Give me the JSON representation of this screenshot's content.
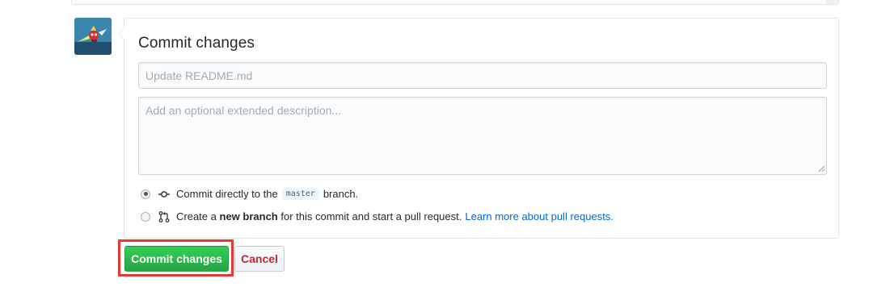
{
  "commit": {
    "title": "Commit changes",
    "summary_placeholder": "Update README.md",
    "summary_value": "",
    "description_placeholder": "Add an optional extended description...",
    "description_value": ""
  },
  "options": {
    "direct": {
      "checked": true,
      "prefix": "Commit directly to the",
      "branch": "master",
      "suffix": "branch."
    },
    "new_branch": {
      "checked": false,
      "prefix": "Create a",
      "bold": "new branch",
      "middle": "for this commit and start a pull request.",
      "link": "Learn more about pull requests."
    }
  },
  "buttons": {
    "commit_label": "Commit changes",
    "cancel_label": "Cancel"
  },
  "colors": {
    "primary_green": "#28a745",
    "danger_red": "#cb2431",
    "link_blue": "#0366d6",
    "highlight_red": "#e53935"
  },
  "icons": {
    "avatar": "user-avatar",
    "commit": "git-commit-icon",
    "pull_request": "git-pull-request-icon"
  }
}
